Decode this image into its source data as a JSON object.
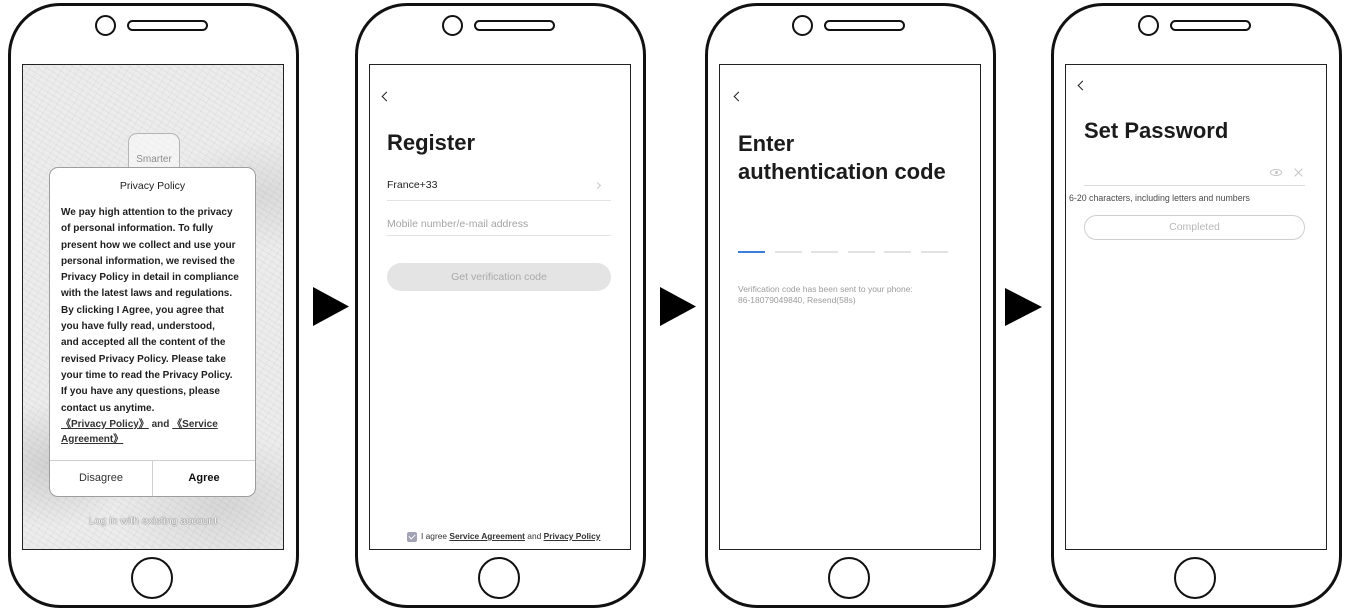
{
  "colors": {
    "accent": "#3a7ddb",
    "disabled_button": "#e4e4e4",
    "checkbox": "#a3a3b6"
  },
  "icons": {
    "flow_arrow": "triangle-right-icon",
    "back": "chevron-left-icon",
    "country_chevron": "chevron-right-icon",
    "password_visibility": "eye-icon",
    "clear_input": "close-icon",
    "agreement_checkbox": "checkbox-checked-icon"
  },
  "privacy": {
    "app_logo_text": "Smarter",
    "dialog": {
      "title": "Privacy Policy",
      "body_lines": [
        "We pay high attention to the privacy",
        "of personal information. To fully",
        "present how we collect and use your",
        "personal information, we revised the",
        "Privacy Policy in detail in compliance",
        "with the latest laws and regulations.",
        "By clicking I Agree, you agree that",
        "you have fully read, understood,",
        "and accepted all the content of the",
        "revised Privacy Policy. Please take",
        "your time to read the Privacy Policy.",
        "If you have any questions, please",
        "contact us anytime."
      ],
      "privacy_policy_link": "《Privacy Policy》",
      "and_text": " and ",
      "service_agreement_link_line1": "《Service",
      "service_agreement_link_line2": "Agreement》",
      "disagree_label": "Disagree",
      "agree_label": "Agree"
    },
    "login_link": "Log in with existing account"
  },
  "register": {
    "title": "Register",
    "country": "France+33",
    "account_placeholder": "Mobile number/e-mail address",
    "get_code_label": "Get verification code",
    "agreement_checked": true,
    "agreement_prefix": "I agree ",
    "service_agreement_link": "Service Agreement",
    "and_text": " and ",
    "privacy_policy_link": "Privacy Policy"
  },
  "auth_code": {
    "title_lines": [
      "Enter",
      "authentication code"
    ],
    "code_length": 6,
    "active_index": 0,
    "message_lines": [
      "Verification code has been sent to your phone:",
      "86-18079049840, Resend(58s)"
    ]
  },
  "set_password": {
    "title": "Set Password",
    "hint": "6-20 characters, including letters and numbers",
    "submit_label": "Completed"
  }
}
